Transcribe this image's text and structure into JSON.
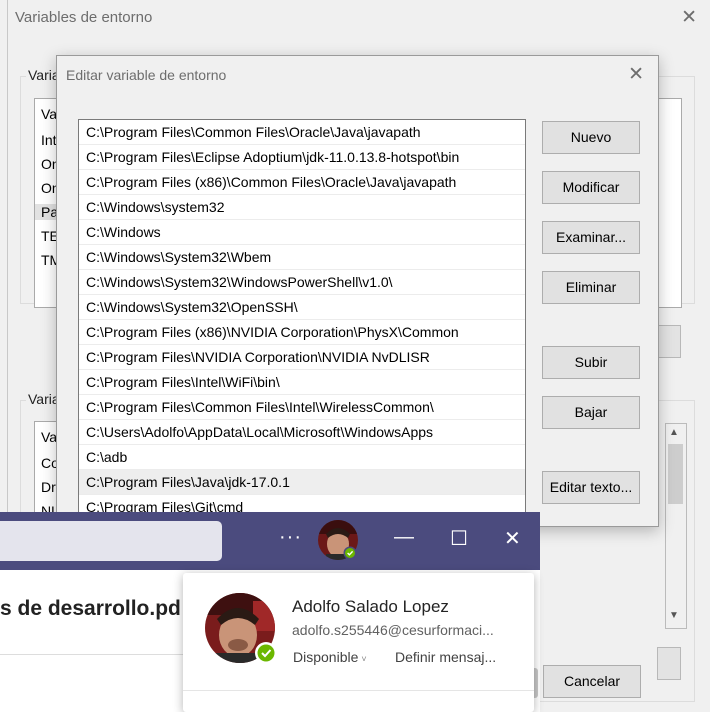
{
  "outer_dialog": {
    "title": "Variables de entorno",
    "user_vars_label": "Varia",
    "user_vars": [
      "Var",
      "Int",
      "On",
      "On",
      "Pa",
      "TE",
      "TM"
    ],
    "system_vars_label": "Varia",
    "system_vars": [
      "Var",
      "Co",
      "Dr",
      "NU"
    ],
    "cancel_label": "Cancelar"
  },
  "inner_dialog": {
    "title": "Editar variable de entorno",
    "paths": [
      "C:\\Program Files\\Common Files\\Oracle\\Java\\javapath",
      "C:\\Program Files\\Eclipse Adoptium\\jdk-11.0.13.8-hotspot\\bin",
      "C:\\Program Files (x86)\\Common Files\\Oracle\\Java\\javapath",
      "C:\\Windows\\system32",
      "C:\\Windows",
      "C:\\Windows\\System32\\Wbem",
      "C:\\Windows\\System32\\WindowsPowerShell\\v1.0\\",
      "C:\\Windows\\System32\\OpenSSH\\",
      "C:\\Program Files (x86)\\NVIDIA Corporation\\PhysX\\Common",
      "C:\\Program Files\\NVIDIA Corporation\\NVIDIA NvDLISR",
      "C:\\Program Files\\Intel\\WiFi\\bin\\",
      "C:\\Program Files\\Common Files\\Intel\\WirelessCommon\\",
      "C:\\Users\\Adolfo\\AppData\\Local\\Microsoft\\WindowsApps",
      "C:\\adb",
      "C:\\Program Files\\Java\\jdk-17.0.1",
      "C:\\Program Files\\Git\\cmd"
    ],
    "selected_index": 14,
    "buttons": {
      "new": "Nuevo",
      "edit": "Modificar",
      "browse": "Examinar...",
      "delete": "Eliminar",
      "up": "Subir",
      "down": "Bajar",
      "edit_text": "Editar texto..."
    }
  },
  "teams": {
    "more_glyph": "···",
    "doc_title": "s de desarrollo.pd",
    "profile": {
      "name": "Adolfo Salado Lopez",
      "email": "adolfo.s255446@cesurformaci...",
      "status": "Disponible",
      "status_color": "#6bb700",
      "set_message": "Definir mensaj..."
    }
  },
  "colors": {
    "teams_bar": "#4b4b7e",
    "dialog_bg": "#f0f0f0"
  }
}
